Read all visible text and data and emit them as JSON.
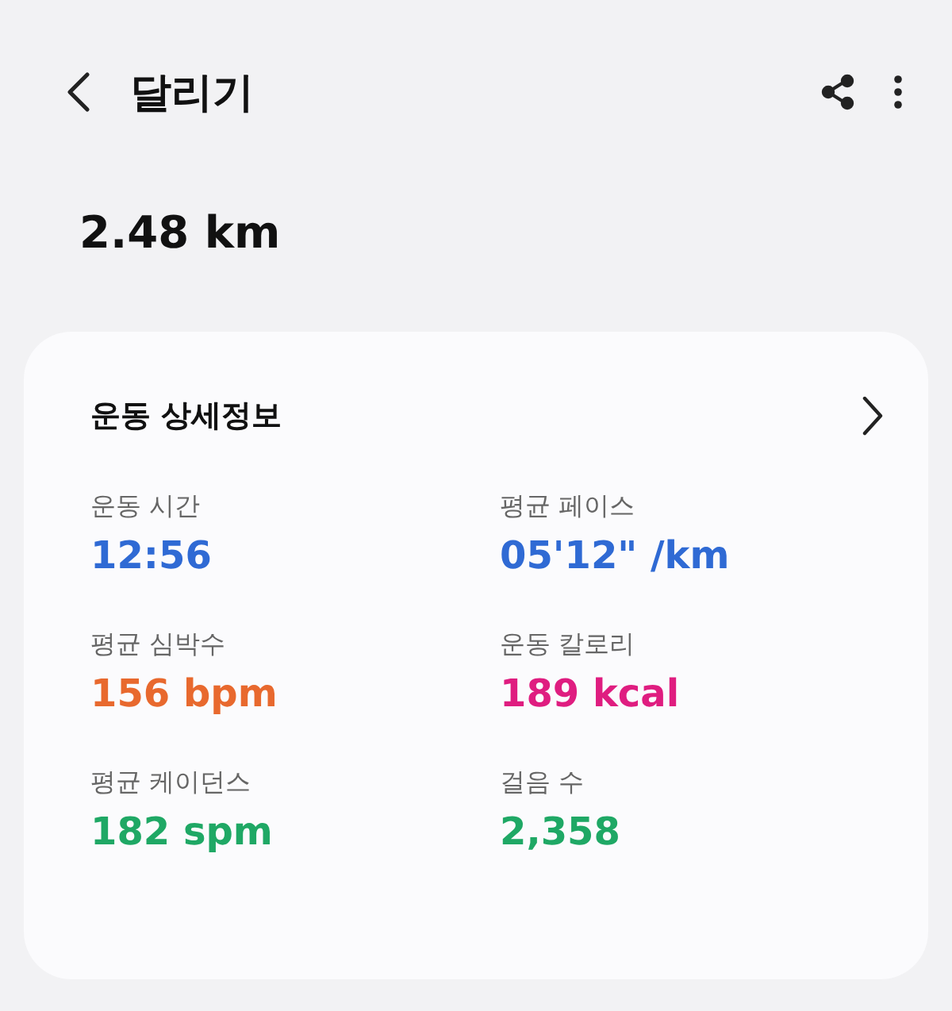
{
  "header": {
    "title": "달리기"
  },
  "distance": "2.48 km",
  "card": {
    "title": "운동 상세정보",
    "metrics": [
      {
        "label": "운동 시간",
        "value": "12:56",
        "color": "#2f6ad4"
      },
      {
        "label": "평균 페이스",
        "value": "05'12\" /km",
        "color": "#2f6ad4"
      },
      {
        "label": "평균 심박수",
        "value": "156 bpm",
        "color": "#e8692e"
      },
      {
        "label": "운동 칼로리",
        "value": "189 kcal",
        "color": "#df1d80"
      },
      {
        "label": "평균 케이던스",
        "value": "182 spm",
        "color": "#1fa865"
      },
      {
        "label": "걸음 수",
        "value": "2,358",
        "color": "#1fa865"
      }
    ]
  }
}
